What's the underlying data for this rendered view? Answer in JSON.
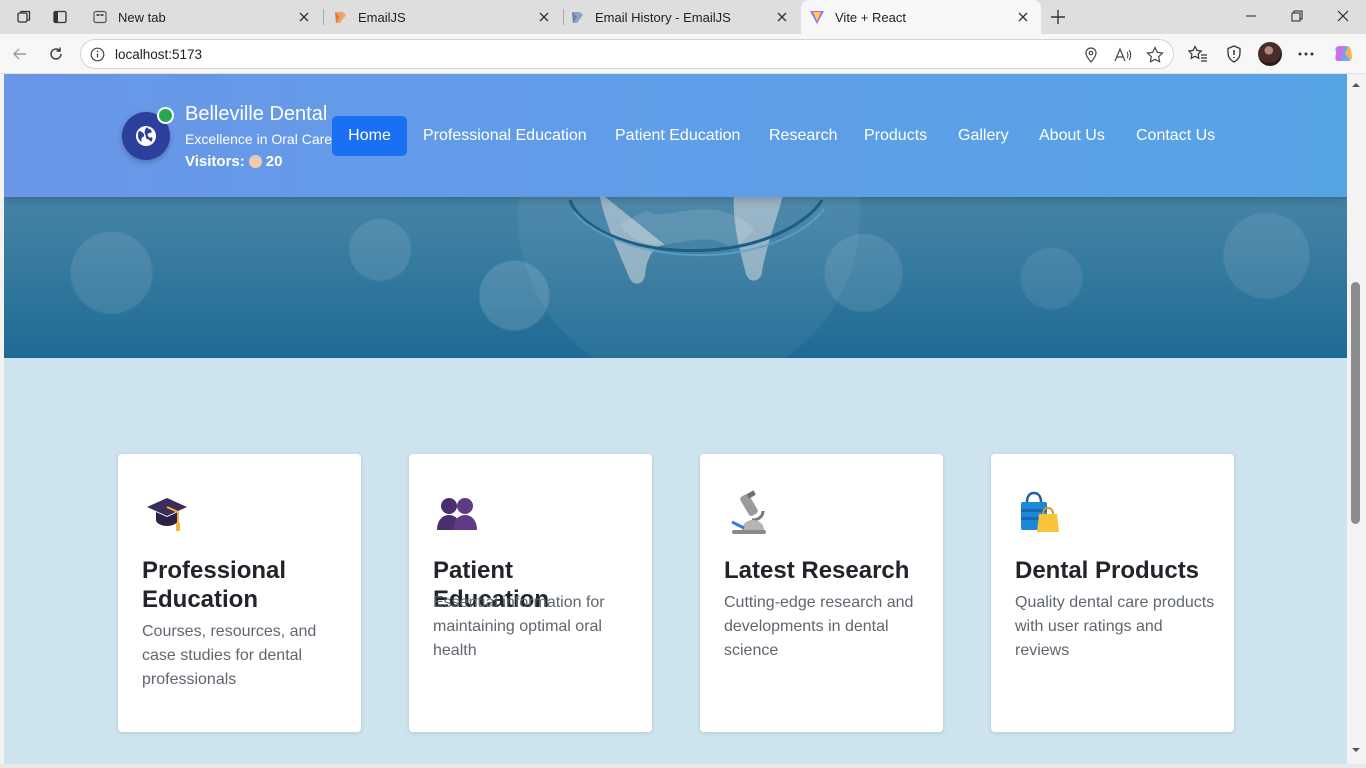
{
  "browser": {
    "tabs": [
      {
        "title": "New tab",
        "active": false
      },
      {
        "title": "EmailJS",
        "active": false
      },
      {
        "title": "Email History - EmailJS",
        "active": false
      },
      {
        "title": "Vite + React",
        "active": true
      }
    ],
    "url": "localhost:5173"
  },
  "site": {
    "brand_name": "Belleville Dental",
    "tagline": "Excellence in Oral Care",
    "visitors_label": "Visitors:",
    "visitors_count": "20",
    "nav": [
      "Home",
      "Professional Education",
      "Patient Education",
      "Research",
      "Products",
      "Gallery",
      "About Us",
      "Contact Us"
    ],
    "active_nav": "Home",
    "colors": {
      "accent": "#1a6ff2",
      "header": "#5f9ee8",
      "page_bg": "#cde3ed",
      "online": "#27a84b"
    }
  },
  "cards": [
    {
      "icon": "graduation-cap-icon",
      "title": "Professional Education",
      "desc": "Courses, resources, and case studies for dental professionals"
    },
    {
      "icon": "people-icon",
      "title": "Patient Education",
      "desc": "Essential information for maintaining optimal oral health"
    },
    {
      "icon": "microscope-icon",
      "title": "Latest Research",
      "desc": "Cutting-edge research and developments in dental science"
    },
    {
      "icon": "shopping-bags-icon",
      "title": "Dental Products",
      "desc": "Quality dental care products with user ratings and reviews"
    }
  ]
}
